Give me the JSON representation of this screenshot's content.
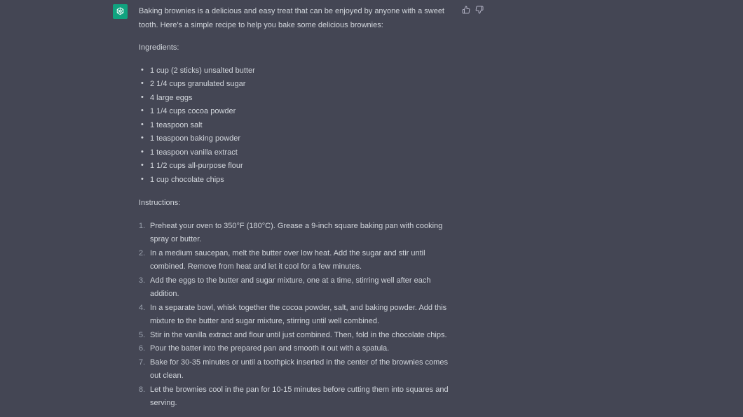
{
  "message": {
    "intro": "Baking brownies is a delicious and easy treat that can be enjoyed by anyone with a sweet tooth. Here's a simple recipe to help you bake some delicious brownies:",
    "ingredients_label": "Ingredients:",
    "ingredients": [
      "1 cup (2 sticks) unsalted butter",
      "2 1/4 cups granulated sugar",
      "4 large eggs",
      "1 1/4 cups cocoa powder",
      "1 teaspoon salt",
      "1 teaspoon baking powder",
      "1 teaspoon vanilla extract",
      "1 1/2 cups all-purpose flour",
      "1 cup chocolate chips"
    ],
    "instructions_label": "Instructions:",
    "steps": [
      {
        "num": "1.",
        "text": "Preheat your oven to 350°F (180°C). Grease a 9-inch square baking pan with cooking spray or butter."
      },
      {
        "num": "2.",
        "text": "In a medium saucepan, melt the butter over low heat. Add the sugar and stir until combined. Remove from heat and let it cool for a few minutes."
      },
      {
        "num": "3.",
        "text": "Add the eggs to the butter and sugar mixture, one at a time, stirring well after each addition."
      },
      {
        "num": "4.",
        "text": "In a separate bowl, whisk together the cocoa powder, salt, and baking powder. Add this mixture to the butter and sugar mixture, stirring until well combined."
      },
      {
        "num": "5.",
        "text": "Stir in the vanilla extract and flour until just combined. Then, fold in the chocolate chips."
      },
      {
        "num": "6.",
        "text": "Pour the batter into the prepared pan and smooth it out with a spatula."
      },
      {
        "num": "7.",
        "text": "Bake for 30-35 minutes or until a toothpick inserted in the center of the brownies comes out clean."
      },
      {
        "num": "8.",
        "text": "Let the brownies cool in the pan for 10-15 minutes before cutting them into squares and serving."
      }
    ]
  },
  "icons": {
    "avatar": "assistant-logo-icon",
    "thumbs_up": "thumbs-up-icon",
    "thumbs_down": "thumbs-down-icon"
  },
  "colors": {
    "background": "#444654",
    "avatar_bg": "#10a37f",
    "text": "#d1d5db"
  }
}
